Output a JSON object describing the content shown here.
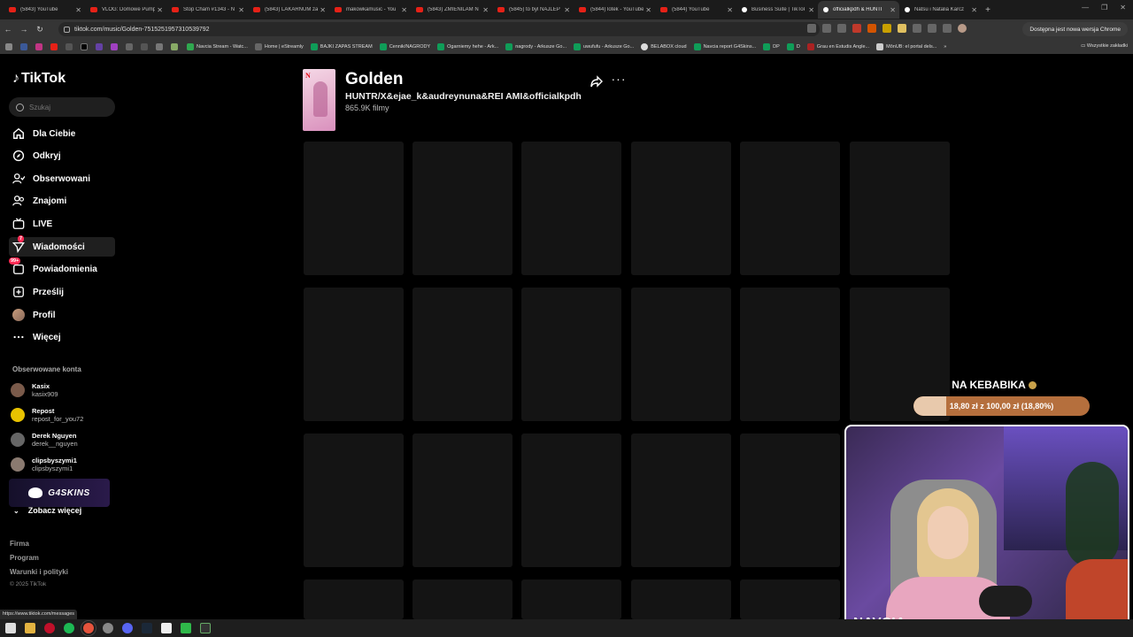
{
  "browser": {
    "tabs": [
      {
        "label": "(5843) YouTube",
        "icon": "youtube-icon",
        "active": false
      },
      {
        "label": "VLOG: Domowe Pump",
        "icon": "youtube-icon",
        "active": false
      },
      {
        "label": "Stop Cham #1343 - N",
        "icon": "youtube-icon",
        "active": false
      },
      {
        "label": "(5843) LAKARNUM za",
        "icon": "youtube-icon",
        "active": false
      },
      {
        "label": "makowkamusic - You",
        "icon": "youtube-icon",
        "active": false
      },
      {
        "label": "(5843) ZMIENILAM N",
        "icon": "youtube-icon",
        "active": false
      },
      {
        "label": "(5845) to byl NAJLEP",
        "icon": "youtube-icon",
        "active": false
      },
      {
        "label": "(5844) lotek - YouTube",
        "icon": "youtube-icon",
        "active": false
      },
      {
        "label": "(5844) YouTube",
        "icon": "youtube-icon",
        "active": false
      },
      {
        "label": "Business Suite | TikTok",
        "icon": "tiktok-icon",
        "active": false
      },
      {
        "label": "officialkpdh & HUNTI",
        "icon": "tiktok-icon",
        "active": true
      },
      {
        "label": "Natsu i Natalia Karcz",
        "icon": "tiktok-icon",
        "active": false
      }
    ],
    "url": "tiktok.com/music/Golden-7515251957310539792",
    "update_label": "Dostępna jest nowa wersja Chrome",
    "bookmarks": [
      {
        "label": "",
        "color": "#3b5998"
      },
      {
        "label": "",
        "color": "#c13584"
      },
      {
        "label": "",
        "color": "#e62117"
      },
      {
        "label": "",
        "color": "#555555"
      },
      {
        "label": "",
        "color": "#000000"
      },
      {
        "label": "",
        "color": "#6441a5"
      },
      {
        "label": "Navcia Stream - Watc...",
        "color": "#2a2a2a"
      },
      {
        "label": "Home | eStreamly",
        "color": "#444444"
      },
      {
        "label": "BAJKI ZAPAS STREAM",
        "color": "#0f9d58"
      },
      {
        "label": "Cennik/NAGRODY",
        "color": "#0f9d58"
      },
      {
        "label": "Ogarniemy hehe - Ark...",
        "color": "#0f9d58"
      },
      {
        "label": "nagrody - Arkusze Go...",
        "color": "#0f9d58"
      },
      {
        "label": "uwufufu - Arkusze Go...",
        "color": "#0f9d58"
      },
      {
        "label": "BELABOX cloud",
        "color": "#dddddd"
      },
      {
        "label": "Navcia report G4Skins...",
        "color": "#0f9d58"
      },
      {
        "label": "DP",
        "color": "#0f9d58"
      },
      {
        "label": "D",
        "color": "#0f9d58"
      },
      {
        "label": "Grau en Estudis Angle...",
        "color": "#aa2222"
      },
      {
        "label": "MônUB: el portal dels...",
        "color": "#cccccc"
      }
    ],
    "bookmarks_all": "Wszystkie zakładki",
    "status_url": "https://www.tiktok.com/messages"
  },
  "sidebar": {
    "logo": "TikTok",
    "search_placeholder": "Szukaj",
    "nav": [
      {
        "label": "Dla Ciebie",
        "icon": "home-icon"
      },
      {
        "label": "Odkryj",
        "icon": "compass-icon"
      },
      {
        "label": "Obserwowani",
        "icon": "following-icon"
      },
      {
        "label": "Znajomi",
        "icon": "friends-icon"
      },
      {
        "label": "LIVE",
        "icon": "live-icon"
      },
      {
        "label": "Wiadomości",
        "icon": "messages-icon",
        "badge": "7"
      },
      {
        "label": "Powiadomienia",
        "icon": "notifications-icon",
        "badge": "99+"
      },
      {
        "label": "Prześlij",
        "icon": "upload-icon"
      },
      {
        "label": "Profil",
        "icon": "profile-avatar"
      },
      {
        "label": "Więcej",
        "icon": "more-icon"
      }
    ],
    "followed_title": "Obserwowane konta",
    "followed": [
      {
        "display": "Kasix",
        "user": "kasix909",
        "color": "#7a5a4a"
      },
      {
        "display": "Repost",
        "user": "repost_for_you72",
        "color": "#e8c200"
      },
      {
        "display": "Derek Nguyen",
        "user": "derek__nguyen",
        "color": "#666666"
      },
      {
        "display": "clipsbyszymi1",
        "user": "clipsbyszymi1",
        "color": "#8a7a70"
      }
    ],
    "promo": "G4SKINS",
    "see_more": "Zobacz więcej",
    "footer": [
      "Firma",
      "Program",
      "Warunki i polityki"
    ],
    "copyright": "© 2025 TikTok"
  },
  "music": {
    "cover_logo": "N",
    "title": "Golden",
    "artists": "HUNTR/X&ejae_k&audreynuna&REI AMI&officialkpdh",
    "count": "865.9K filmy"
  },
  "overlay": {
    "goal_title": "NA KEBABIKA",
    "goal_text": "18,80 zł z 100,00 zł (18,80%)",
    "goal_fraction": 0.188,
    "webcam_name": "NAVCIA"
  }
}
